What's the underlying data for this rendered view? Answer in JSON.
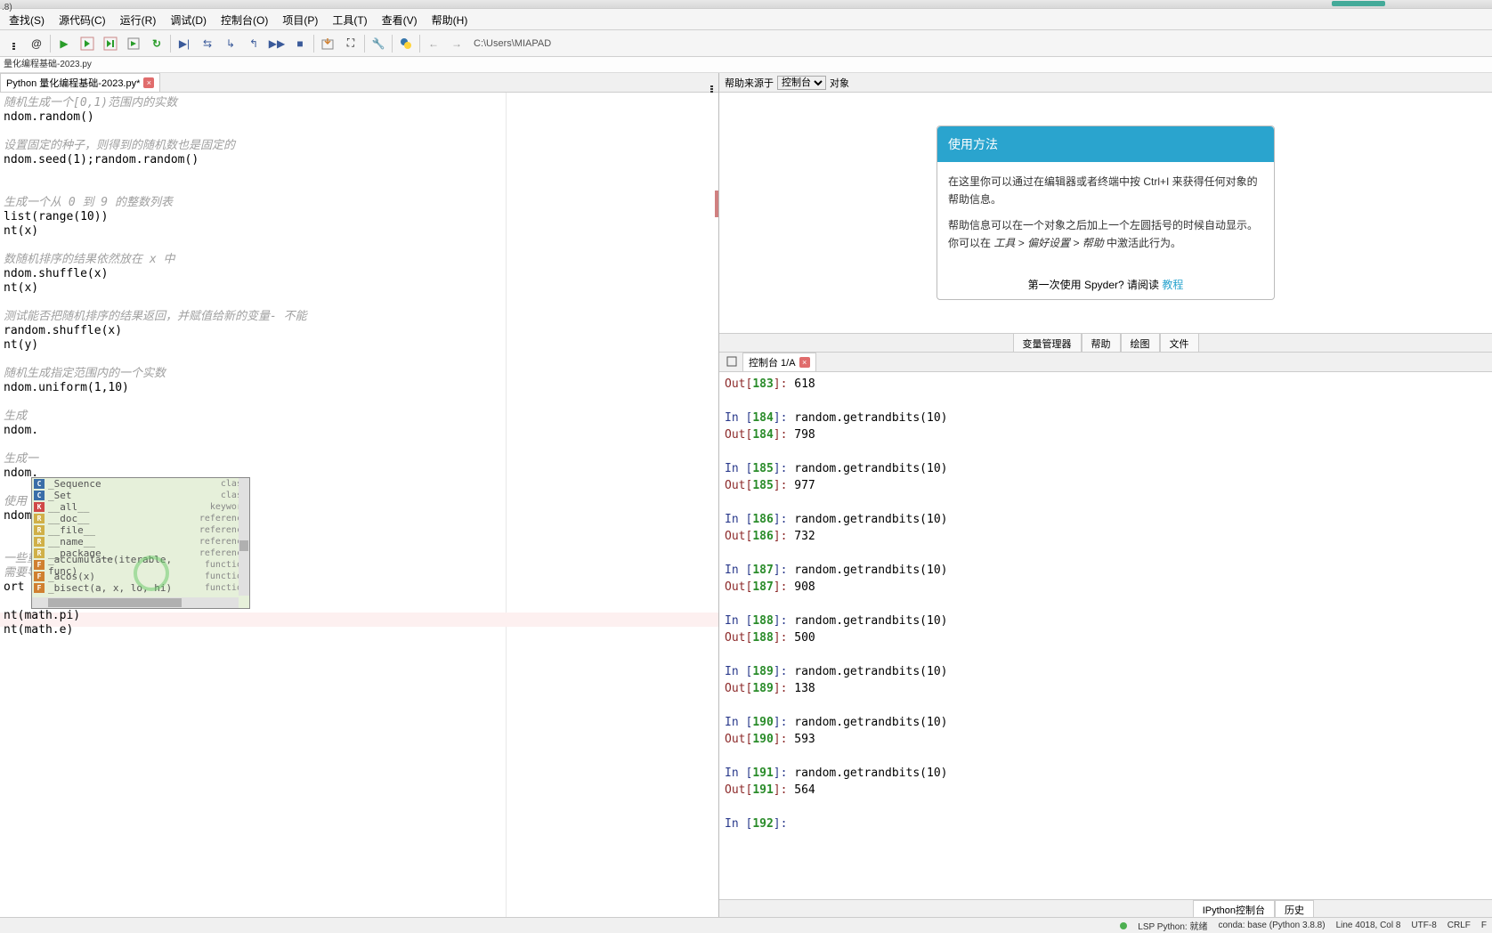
{
  "title_suffix": ".8)",
  "menu": [
    "查找(S)",
    "源代码(C)",
    "运行(R)",
    "调试(D)",
    "控制台(O)",
    "项目(P)",
    "工具(T)",
    "查看(V)",
    "帮助(H)"
  ],
  "path": "C:\\Users\\MIAPAD",
  "breadcrumb": "量化编程基础-2023.py",
  "tab_name": "Python 量化编程基础-2023.py*",
  "code_lines": [
    {
      "t": "随机生成一个[0,1)范围内的实数",
      "c": true
    },
    {
      "t": "ndom.random()"
    },
    {
      "t": ""
    },
    {
      "t": "设置固定的种子，则得到的随机数也是固定的",
      "c": true
    },
    {
      "t": "ndom.seed(1);random.random()"
    },
    {
      "t": ""
    },
    {
      "t": ""
    },
    {
      "t": "生成一个从 0 到 9 的整数列表",
      "c": true
    },
    {
      "t": "list(range(10))"
    },
    {
      "t": "nt(x)"
    },
    {
      "t": ""
    },
    {
      "t": "数随机排序的结果依然放在 x 中",
      "c": true
    },
    {
      "t": "ndom.shuffle(x)"
    },
    {
      "t": "nt(x)"
    },
    {
      "t": ""
    },
    {
      "t": "测试能否把随机排序的结果返回，并赋值给新的变量- 不能",
      "c": true
    },
    {
      "t": "random.shuffle(x)"
    },
    {
      "t": "nt(y)"
    },
    {
      "t": ""
    },
    {
      "t": "随机生成指定范围内的一个实数",
      "c": true
    },
    {
      "t": "ndom.uniform(1,10)"
    },
    {
      "t": ""
    },
    {
      "t": "生成",
      "c": true
    },
    {
      "t": "ndom."
    },
    {
      "t": ""
    },
    {
      "t": "生成一",
      "c": true
    },
    {
      "t": "ndom."
    },
    {
      "t": ""
    },
    {
      "t": "使用",
      "c": true
    },
    {
      "t": "ndom."
    },
    {
      "t": ""
    },
    {
      "t": ""
    },
    {
      "t": "一些重要的数学常数",
      "c": true
    },
    {
      "t": "需要导入 math 模块才能调用",
      "c": true
    },
    {
      "t": "ort math"
    },
    {
      "t": ""
    },
    {
      "t": "nt(math.pi)"
    },
    {
      "t": "nt(math.e)"
    }
  ],
  "autocomplete": [
    {
      "icon": "c",
      "name": "_Sequence",
      "type": "class"
    },
    {
      "icon": "c",
      "name": "_Set",
      "type": "class"
    },
    {
      "icon": "k",
      "name": "__all__",
      "type": "keyword"
    },
    {
      "icon": "r",
      "name": "__doc__",
      "type": "reference"
    },
    {
      "icon": "r",
      "name": "__file__",
      "type": "reference"
    },
    {
      "icon": "r",
      "name": "__name__",
      "type": "reference"
    },
    {
      "icon": "r",
      "name": "__package__",
      "type": "reference"
    },
    {
      "icon": "f",
      "name": "_accumulate(iterable, func)",
      "type": "function"
    },
    {
      "icon": "f",
      "name": "_acos(x)",
      "type": "function"
    },
    {
      "icon": "f",
      "name": "_bisect(a, x, lo, hi)",
      "type": "function"
    }
  ],
  "help": {
    "source_label": "帮助来源于",
    "dropdown": "控制台",
    "object_label": "对象",
    "card_title": "使用方法",
    "para1": "在这里你可以通过在编辑器或者终端中按 Ctrl+I 来获得任何对象的帮助信息。",
    "para2_a": "帮助信息可以在一个对象之后加上一个左圆括号的时候自动显示。你可以在 ",
    "para2_b": "工具 > 偏好设置 > 帮助",
    "para2_c": " 中激活此行为。",
    "footer_q": "第一次使用 Spyder? 请阅读 ",
    "footer_link": "教程"
  },
  "right_tabs": [
    "变量管理器",
    "帮助",
    "绘图",
    "文件"
  ],
  "console_tab": "控制台 1/A",
  "console_lines": [
    {
      "p": "Out",
      "n": "183",
      "v": "618"
    },
    {
      "sep": true
    },
    {
      "p": "In ",
      "n": "184",
      "v": "random.getrandbits(10)"
    },
    {
      "p": "Out",
      "n": "184",
      "v": "798"
    },
    {
      "sep": true
    },
    {
      "p": "In ",
      "n": "185",
      "v": "random.getrandbits(10)"
    },
    {
      "p": "Out",
      "n": "185",
      "v": "977"
    },
    {
      "sep": true
    },
    {
      "p": "In ",
      "n": "186",
      "v": "random.getrandbits(10)"
    },
    {
      "p": "Out",
      "n": "186",
      "v": "732"
    },
    {
      "sep": true
    },
    {
      "p": "In ",
      "n": "187",
      "v": "random.getrandbits(10)"
    },
    {
      "p": "Out",
      "n": "187",
      "v": "908"
    },
    {
      "sep": true
    },
    {
      "p": "In ",
      "n": "188",
      "v": "random.getrandbits(10)"
    },
    {
      "p": "Out",
      "n": "188",
      "v": "500"
    },
    {
      "sep": true
    },
    {
      "p": "In ",
      "n": "189",
      "v": "random.getrandbits(10)"
    },
    {
      "p": "Out",
      "n": "189",
      "v": "138"
    },
    {
      "sep": true
    },
    {
      "p": "In ",
      "n": "190",
      "v": "random.getrandbits(10)"
    },
    {
      "p": "Out",
      "n": "190",
      "v": "593"
    },
    {
      "sep": true
    },
    {
      "p": "In ",
      "n": "191",
      "v": "random.getrandbits(10)"
    },
    {
      "p": "Out",
      "n": "191",
      "v": "564"
    },
    {
      "sep": true
    },
    {
      "p": "In ",
      "n": "192",
      "v": ""
    }
  ],
  "console_bottom": [
    "IPython控制台",
    "历史"
  ],
  "status": {
    "lsp": "LSP Python: 就绪",
    "conda": "conda: base (Python 3.8.8)",
    "pos": "Line 4018, Col 8",
    "enc": "UTF-8",
    "eol": "CRLF",
    "rw": "F"
  }
}
